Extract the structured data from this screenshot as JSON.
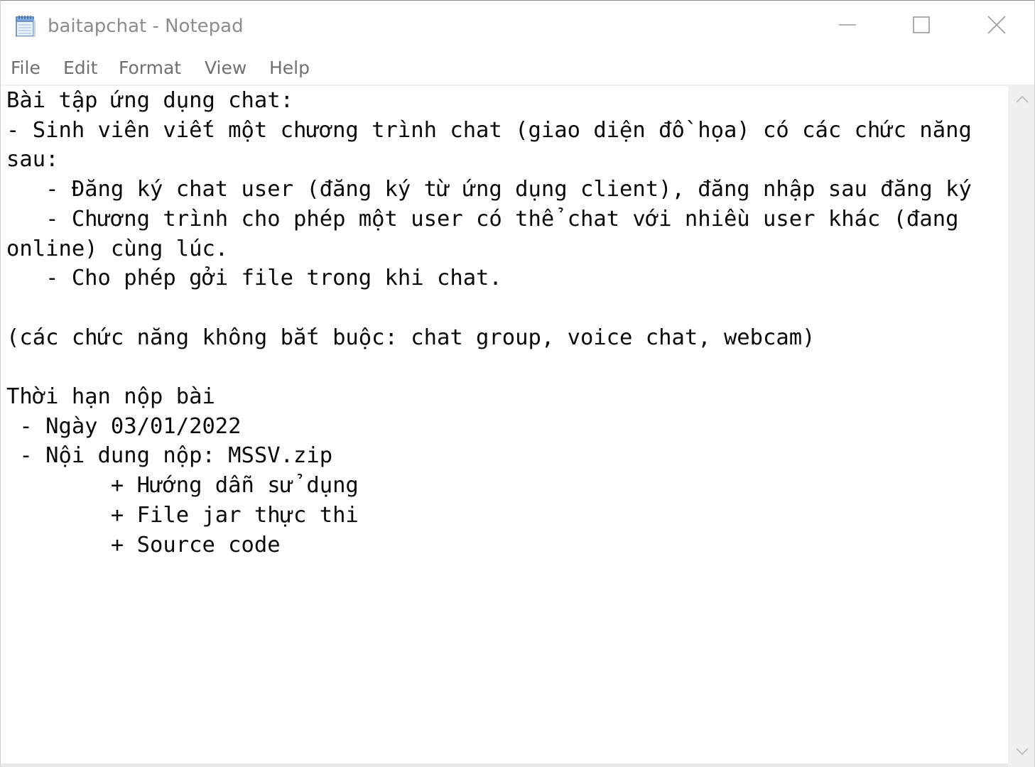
{
  "window": {
    "title": "baitapchat - Notepad",
    "icons": {
      "app": "notepad-icon",
      "minimize": "minimize-icon",
      "maximize": "maximize-icon",
      "close": "close-icon"
    }
  },
  "menu": {
    "file": "File",
    "edit": "Edit",
    "format": "Format",
    "view": "View",
    "help": "Help"
  },
  "editor": {
    "content": "Bài tập ứng dụng chat:\n- Sinh viên viết một chương trình chat (giao diện đồ họa) có các chức năng\nsau:\n   - Đăng ký chat user (đăng ký từ ứng dụng client), đăng nhập sau đăng ký\n   - Chương trình cho phép một user có thể chat với nhiều user khác (đang\nonline) cùng lúc.\n   - Cho phép gởi file trong khi chat.\n\n(các chức năng không bắt buộc: chat group, voice chat, webcam)\n\nThời hạn nộp bài\n - Ngày 03/01/2022\n - Nội dung nộp: MSSV.zip\n        + Hướng dẫn sử dụng\n        + File jar thực thi\n        + Source code"
  },
  "scrollbar": {
    "up_icon": "chevron-up-icon",
    "down_icon": "chevron-down-icon"
  },
  "colors": {
    "title_text": "#8c8c8c",
    "menu_text": "#707070",
    "editor_text": "#0a0a0a",
    "scrollbar_track": "#f0f0f0"
  }
}
